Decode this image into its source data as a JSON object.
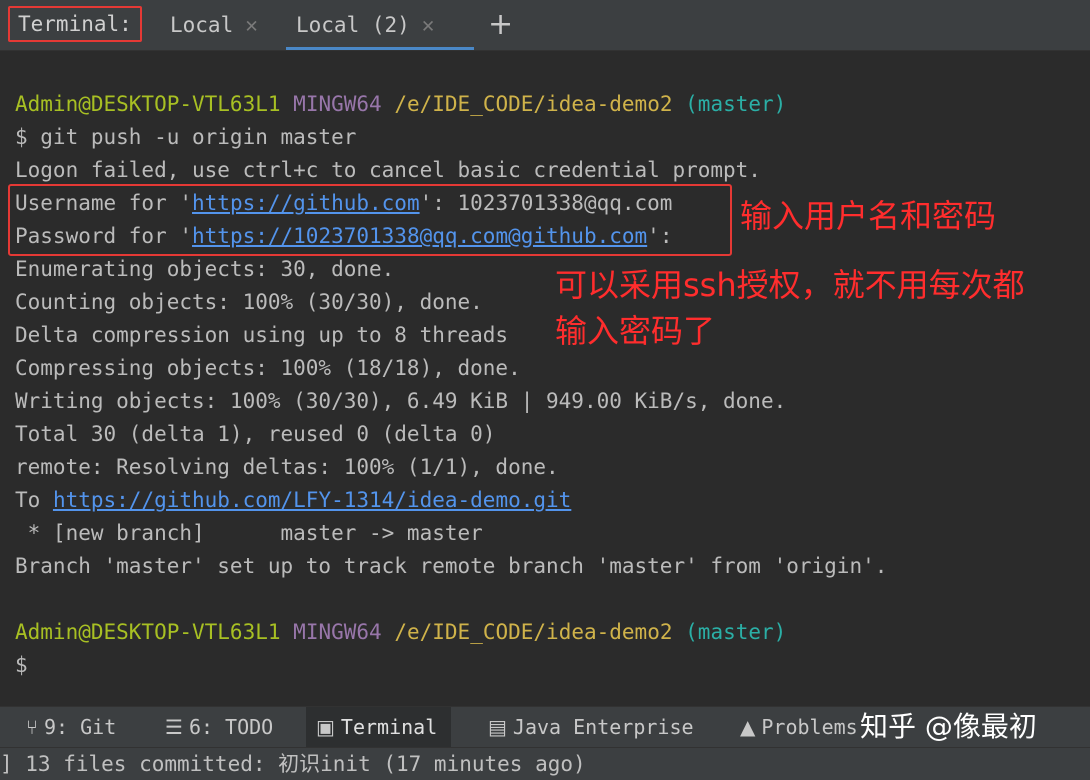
{
  "tabs": {
    "label": "Terminal:",
    "items": [
      {
        "label": "Local"
      },
      {
        "label": "Local (2)"
      }
    ],
    "add_symbol": "+"
  },
  "terminal": {
    "prompt1": {
      "user": "Admin@DESKTOP-VTL63L1",
      "env": "MINGW64",
      "path": "/e/IDE_CODE/idea-demo2",
      "branch": "(master)"
    },
    "command": "$ git push -u origin master",
    "logon": "Logon failed, use ctrl+c to cancel basic credential prompt.",
    "username": {
      "prefix": "Username for '",
      "url": "https://github.com",
      "suffix": "': 1023701338@qq.com"
    },
    "password": {
      "prefix": "Password for '",
      "url": "https://1023701338@qq.com@github.com",
      "suffix": "':"
    },
    "output": [
      "Enumerating objects: 30, done.",
      "Counting objects: 100% (30/30), done.",
      "Delta compression using up to 8 threads",
      "Compressing objects: 100% (18/18), done.",
      "Writing objects: 100% (30/30), 6.49 KiB | 949.00 KiB/s, done.",
      "Total 30 (delta 1), reused 0 (delta 0)",
      "remote: Resolving deltas: 100% (1/1), done."
    ],
    "to": {
      "prefix": "To ",
      "url": "https://github.com/LFY-1314/idea-demo.git"
    },
    "new_branch": " * [new branch]      master -> master",
    "branch_set": "Branch 'master' set up to track remote branch 'master' from 'origin'.",
    "prompt2": {
      "user": "Admin@DESKTOP-VTL63L1",
      "env": "MINGW64",
      "path": "/e/IDE_CODE/idea-demo2",
      "branch": "(master)"
    },
    "cursor_prompt": "$"
  },
  "annotations": {
    "note1": "输入用户名和密码",
    "note2_line1": "可以采用ssh授权，就不用每次都",
    "note2_line2": "输入密码了"
  },
  "toolwindows": [
    {
      "icon": "git-branch-icon",
      "label": "9: Git"
    },
    {
      "icon": "todo-list-icon",
      "label": "6: TODO"
    },
    {
      "icon": "terminal-icon",
      "label": "Terminal"
    },
    {
      "icon": "java-enterprise-icon",
      "label": "Java Enterprise"
    },
    {
      "icon": "warning-icon",
      "label": "Problems"
    }
  ],
  "watermark": "知乎 @像最初",
  "status": {
    "text": "] 13 files committed: 初识init (17 minutes ago)"
  },
  "colors": {
    "accent": "#4a88c7",
    "highlight": "#e53935",
    "annotation": "#ff2d2d",
    "link": "#5394ec"
  }
}
